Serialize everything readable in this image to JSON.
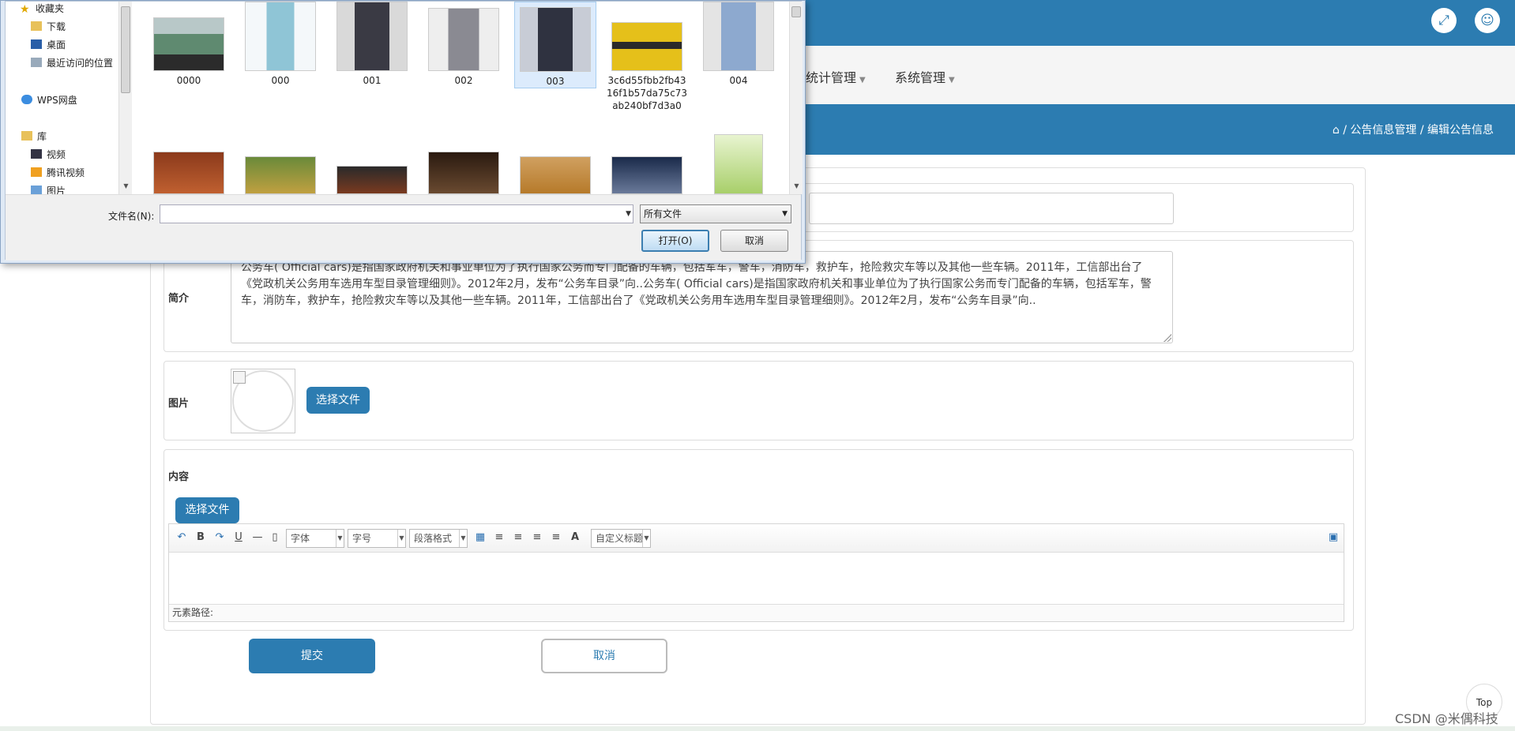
{
  "top_bar": {
    "fullscreen_icon": "expand-icon",
    "user_icon": "user-icon"
  },
  "nav": {
    "items": [
      "统计管理",
      "系统管理"
    ]
  },
  "breadcrumb": {
    "home_icon": "home-icon",
    "sep": "/",
    "items": [
      "公告信息管理",
      "编辑公告信息"
    ]
  },
  "form": {
    "title_value": "",
    "intro_label": "简介",
    "intro_text": "公务车( Official cars)是指国家政府机关和事业单位为了执行国家公务而专门配备的车辆，包括军车，警车，消防车，救护车，抢险救灾车等以及其他一些车辆。2011年，工信部出台了《党政机关公务用车选用车型目录管理细则》。2012年2月，发布“公务车目录”向..公务车( Official cars)是指国家政府机关和事业单位为了执行国家公务而专门配备的车辆，包括军车，警车，消防车，救护车，抢险救灾车等以及其他一些车辆。2011年，工信部出台了《党政机关公务用车选用车型目录管理细则》。2012年2月，发布“公务车目录”向..",
    "image_label": "图片",
    "choose_file": "选择文件",
    "content_label": "内容",
    "content_choose_file": "选择文件",
    "editor": {
      "font_select": "字体",
      "size_select": "字号",
      "para_select": "段落格式",
      "custom_title_select": "自定义标题",
      "element_path": "元素路径:"
    },
    "submit": "提交",
    "cancel": "取消"
  },
  "top_button": "Top",
  "watermark": "CSDN @米偶科技",
  "file_dialog": {
    "nav_items": [
      {
        "label": "收藏夹",
        "icon": "star-icon"
      },
      {
        "label": "下载",
        "icon": "folder-icon"
      },
      {
        "label": "桌面",
        "icon": "desktop-icon"
      },
      {
        "label": "最近访问的位置",
        "icon": "recent-icon"
      },
      {
        "label": "WPS网盘",
        "icon": "cloud-icon"
      },
      {
        "label": "库",
        "icon": "library-icon"
      },
      {
        "label": "视频",
        "icon": "video-icon"
      },
      {
        "label": "腾讯视频",
        "icon": "folder-icon"
      },
      {
        "label": "图片",
        "icon": "picture-icon"
      }
    ],
    "files": [
      {
        "name": "0000",
        "thumb": "bus-photo",
        "color": "#6f8a7a"
      },
      {
        "name": "000",
        "thumb": "cosmetic-bottle",
        "color": "#8fc5d6"
      },
      {
        "name": "001",
        "thumb": "woman-suit",
        "color": "#3a3a44"
      },
      {
        "name": "002",
        "thumb": "woman-grey-suit",
        "color": "#8a8a92"
      },
      {
        "name": "003",
        "thumb": "man-suit",
        "color": "#2f3240"
      },
      {
        "name": "3c6d55fbb2fb4316f1b57da75c73ab240bf7d3a0",
        "thumb": "finance-ad",
        "color": "#e5c01a"
      },
      {
        "name": "004",
        "thumb": "man-blue-shirt",
        "color": "#8da9cf"
      },
      {
        "name": "",
        "thumb": "bbq-food",
        "color": "#8b3a1c"
      },
      {
        "name": "",
        "thumb": "hotpot-food",
        "color": "#7a6a3a"
      },
      {
        "name": "",
        "thumb": "grill-food",
        "color": "#5a2a18"
      },
      {
        "name": "",
        "thumb": "restaurant-interior",
        "color": "#4a3020"
      },
      {
        "name": "",
        "thumb": "cafe-seats",
        "color": "#b67a2a"
      },
      {
        "name": "",
        "thumb": "office-room",
        "color": "#3a4a6a"
      },
      {
        "name": "",
        "thumb": "tea-drink-poster",
        "color": "#a8cf6a"
      }
    ],
    "selected_file": "003",
    "filename_label": "文件名(N):",
    "filename_value": "",
    "filetype": "所有文件",
    "open_button": "打开(O)",
    "cancel_button": "取消"
  }
}
